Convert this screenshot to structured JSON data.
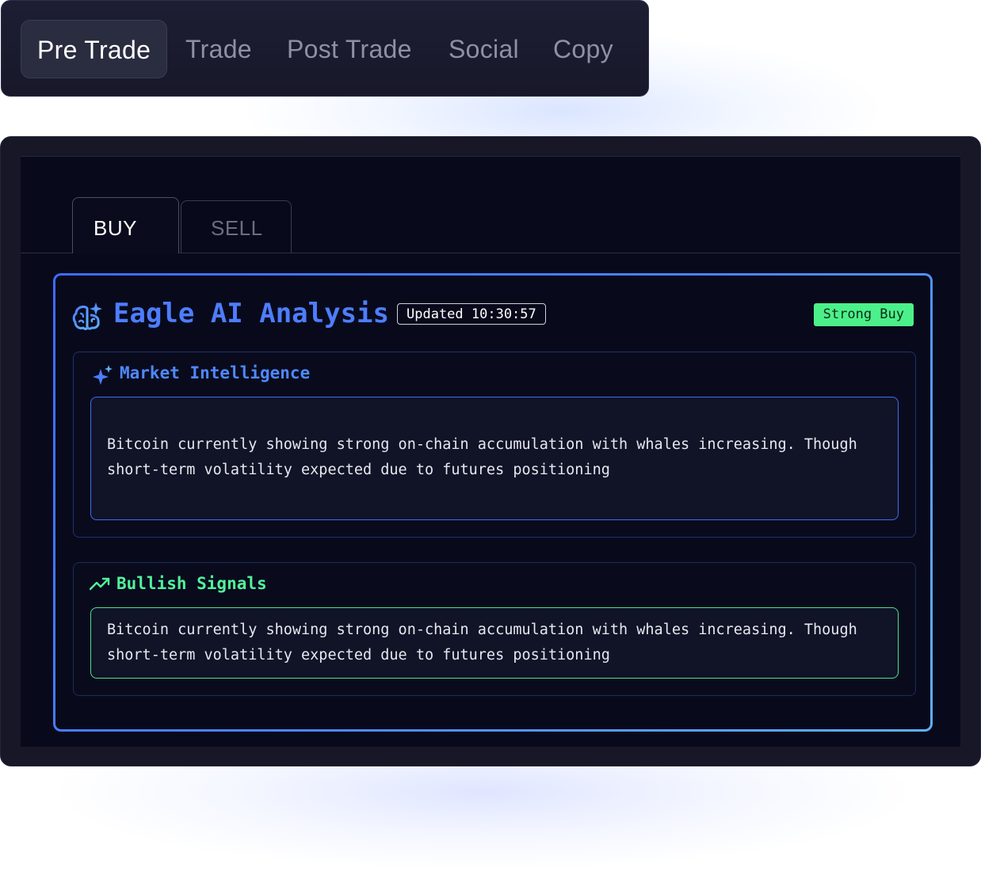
{
  "nav": {
    "items": [
      {
        "label": "Pre Trade",
        "active": true
      },
      {
        "label": "Trade",
        "active": false
      },
      {
        "label": "Post Trade",
        "active": false
      },
      {
        "label": "Social",
        "active": false
      },
      {
        "label": "Copy",
        "active": false
      }
    ]
  },
  "tabs": {
    "buy": "BUY",
    "sell": "SELL"
  },
  "analysis": {
    "title": "Eagle AI Analysis",
    "updated": "Updated 10:30:57",
    "signal": "Strong Buy",
    "icon": "brain-sparkle-icon"
  },
  "market_intelligence": {
    "title": "Market Intelligence",
    "icon": "sparkle-icon",
    "text": "Bitcoin currently showing strong on-chain accumulation with whales increasing. Though short-term volatility expected due to futures positioning"
  },
  "bullish_signals": {
    "title": "Bullish Signals",
    "icon": "trending-up-icon",
    "text": "Bitcoin currently showing strong on-chain accumulation with whales increasing. Though short-term volatility expected due to futures positioning"
  },
  "colors": {
    "accent_blue": "#4d7dff",
    "accent_green": "#4cf08a",
    "background": "#080a1c"
  }
}
